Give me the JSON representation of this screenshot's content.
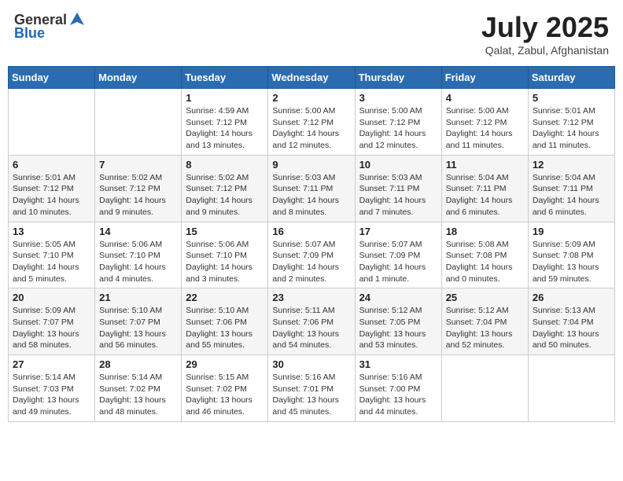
{
  "header": {
    "logo_general": "General",
    "logo_blue": "Blue",
    "month_title": "July 2025",
    "subtitle": "Qalat, Zabul, Afghanistan"
  },
  "days_of_week": [
    "Sunday",
    "Monday",
    "Tuesday",
    "Wednesday",
    "Thursday",
    "Friday",
    "Saturday"
  ],
  "weeks": [
    [
      {
        "day": "",
        "info": ""
      },
      {
        "day": "",
        "info": ""
      },
      {
        "day": "1",
        "info": "Sunrise: 4:59 AM\nSunset: 7:12 PM\nDaylight: 14 hours and 13 minutes."
      },
      {
        "day": "2",
        "info": "Sunrise: 5:00 AM\nSunset: 7:12 PM\nDaylight: 14 hours and 12 minutes."
      },
      {
        "day": "3",
        "info": "Sunrise: 5:00 AM\nSunset: 7:12 PM\nDaylight: 14 hours and 12 minutes."
      },
      {
        "day": "4",
        "info": "Sunrise: 5:00 AM\nSunset: 7:12 PM\nDaylight: 14 hours and 11 minutes."
      },
      {
        "day": "5",
        "info": "Sunrise: 5:01 AM\nSunset: 7:12 PM\nDaylight: 14 hours and 11 minutes."
      }
    ],
    [
      {
        "day": "6",
        "info": "Sunrise: 5:01 AM\nSunset: 7:12 PM\nDaylight: 14 hours and 10 minutes."
      },
      {
        "day": "7",
        "info": "Sunrise: 5:02 AM\nSunset: 7:12 PM\nDaylight: 14 hours and 9 minutes."
      },
      {
        "day": "8",
        "info": "Sunrise: 5:02 AM\nSunset: 7:12 PM\nDaylight: 14 hours and 9 minutes."
      },
      {
        "day": "9",
        "info": "Sunrise: 5:03 AM\nSunset: 7:11 PM\nDaylight: 14 hours and 8 minutes."
      },
      {
        "day": "10",
        "info": "Sunrise: 5:03 AM\nSunset: 7:11 PM\nDaylight: 14 hours and 7 minutes."
      },
      {
        "day": "11",
        "info": "Sunrise: 5:04 AM\nSunset: 7:11 PM\nDaylight: 14 hours and 6 minutes."
      },
      {
        "day": "12",
        "info": "Sunrise: 5:04 AM\nSunset: 7:11 PM\nDaylight: 14 hours and 6 minutes."
      }
    ],
    [
      {
        "day": "13",
        "info": "Sunrise: 5:05 AM\nSunset: 7:10 PM\nDaylight: 14 hours and 5 minutes."
      },
      {
        "day": "14",
        "info": "Sunrise: 5:06 AM\nSunset: 7:10 PM\nDaylight: 14 hours and 4 minutes."
      },
      {
        "day": "15",
        "info": "Sunrise: 5:06 AM\nSunset: 7:10 PM\nDaylight: 14 hours and 3 minutes."
      },
      {
        "day": "16",
        "info": "Sunrise: 5:07 AM\nSunset: 7:09 PM\nDaylight: 14 hours and 2 minutes."
      },
      {
        "day": "17",
        "info": "Sunrise: 5:07 AM\nSunset: 7:09 PM\nDaylight: 14 hours and 1 minute."
      },
      {
        "day": "18",
        "info": "Sunrise: 5:08 AM\nSunset: 7:08 PM\nDaylight: 14 hours and 0 minutes."
      },
      {
        "day": "19",
        "info": "Sunrise: 5:09 AM\nSunset: 7:08 PM\nDaylight: 13 hours and 59 minutes."
      }
    ],
    [
      {
        "day": "20",
        "info": "Sunrise: 5:09 AM\nSunset: 7:07 PM\nDaylight: 13 hours and 58 minutes."
      },
      {
        "day": "21",
        "info": "Sunrise: 5:10 AM\nSunset: 7:07 PM\nDaylight: 13 hours and 56 minutes."
      },
      {
        "day": "22",
        "info": "Sunrise: 5:10 AM\nSunset: 7:06 PM\nDaylight: 13 hours and 55 minutes."
      },
      {
        "day": "23",
        "info": "Sunrise: 5:11 AM\nSunset: 7:06 PM\nDaylight: 13 hours and 54 minutes."
      },
      {
        "day": "24",
        "info": "Sunrise: 5:12 AM\nSunset: 7:05 PM\nDaylight: 13 hours and 53 minutes."
      },
      {
        "day": "25",
        "info": "Sunrise: 5:12 AM\nSunset: 7:04 PM\nDaylight: 13 hours and 52 minutes."
      },
      {
        "day": "26",
        "info": "Sunrise: 5:13 AM\nSunset: 7:04 PM\nDaylight: 13 hours and 50 minutes."
      }
    ],
    [
      {
        "day": "27",
        "info": "Sunrise: 5:14 AM\nSunset: 7:03 PM\nDaylight: 13 hours and 49 minutes."
      },
      {
        "day": "28",
        "info": "Sunrise: 5:14 AM\nSunset: 7:02 PM\nDaylight: 13 hours and 48 minutes."
      },
      {
        "day": "29",
        "info": "Sunrise: 5:15 AM\nSunset: 7:02 PM\nDaylight: 13 hours and 46 minutes."
      },
      {
        "day": "30",
        "info": "Sunrise: 5:16 AM\nSunset: 7:01 PM\nDaylight: 13 hours and 45 minutes."
      },
      {
        "day": "31",
        "info": "Sunrise: 5:16 AM\nSunset: 7:00 PM\nDaylight: 13 hours and 44 minutes."
      },
      {
        "day": "",
        "info": ""
      },
      {
        "day": "",
        "info": ""
      }
    ]
  ]
}
